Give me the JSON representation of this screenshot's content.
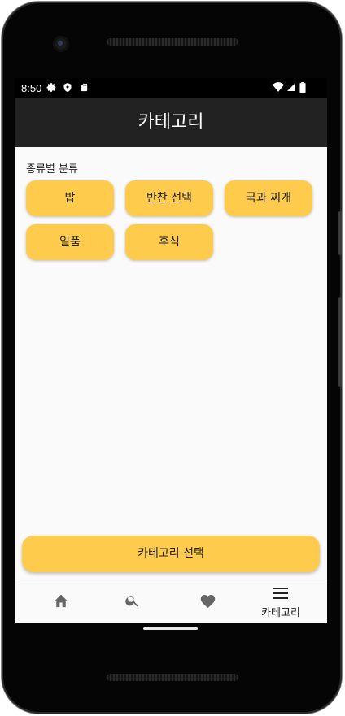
{
  "status_bar": {
    "time": "8:50",
    "left_icons": [
      "gear-icon",
      "shield-icon",
      "sd-card-icon"
    ],
    "right_icons": [
      "wifi-icon",
      "signal-icon",
      "battery-icon"
    ]
  },
  "app_bar": {
    "title": "카테고리"
  },
  "section": {
    "label": "종류별 분류"
  },
  "categories": [
    {
      "label": "밥"
    },
    {
      "label": "반찬 선택"
    },
    {
      "label": "국과 찌개"
    },
    {
      "label": "일품"
    },
    {
      "label": "후식"
    }
  ],
  "action": {
    "select_label": "카테고리 선택"
  },
  "bottom_nav": {
    "items": [
      {
        "icon": "home-icon",
        "label": ""
      },
      {
        "icon": "search-icon",
        "label": ""
      },
      {
        "icon": "heart-icon",
        "label": ""
      },
      {
        "icon": "menu-icon",
        "label": "카테고리"
      }
    ]
  },
  "colors": {
    "accent": "#fecb4c",
    "app_bar": "#222222",
    "background": "#fafafa"
  }
}
